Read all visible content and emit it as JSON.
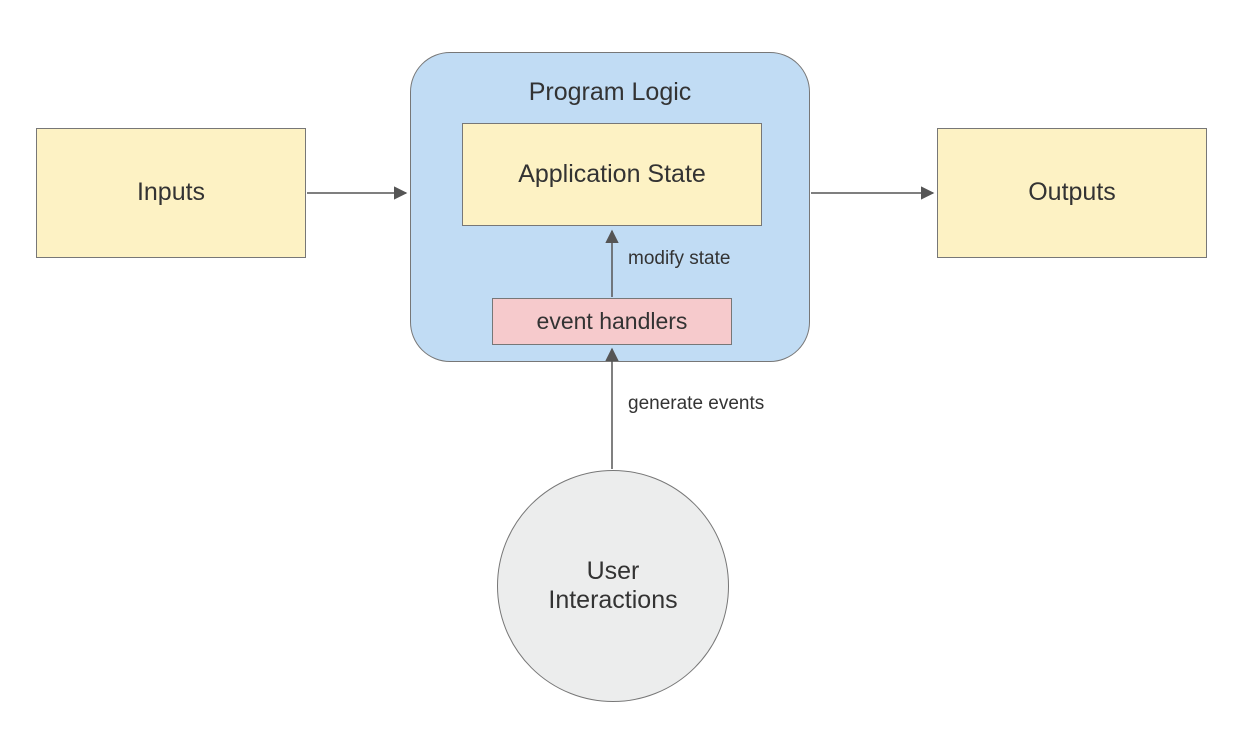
{
  "diagram": {
    "type": "flow",
    "nodes": {
      "inputs": {
        "label": "Inputs",
        "shape": "rect",
        "fill": "yellow"
      },
      "outputs": {
        "label": "Outputs",
        "shape": "rect",
        "fill": "yellow"
      },
      "program_logic": {
        "label": "Program Logic",
        "shape": "rounded-rect",
        "fill": "blue"
      },
      "application_state": {
        "label": "Application State",
        "shape": "rect",
        "fill": "yellow"
      },
      "event_handlers": {
        "label": "event handlers",
        "shape": "rect",
        "fill": "pink"
      },
      "user_interactions": {
        "label": "User\nInteractions",
        "shape": "circle",
        "fill": "grey"
      }
    },
    "edges": [
      {
        "from": "inputs",
        "to": "program_logic"
      },
      {
        "from": "program_logic",
        "to": "outputs"
      },
      {
        "from": "event_handlers",
        "to": "application_state",
        "label": "modify state"
      },
      {
        "from": "user_interactions",
        "to": "event_handlers",
        "label": "generate events"
      }
    ]
  },
  "colors": {
    "yellow": "#fdf2c4",
    "pink": "#f6cacc",
    "blue": "#c1dcf4",
    "grey": "#eceded",
    "stroke": "#777777",
    "text": "#333333"
  }
}
